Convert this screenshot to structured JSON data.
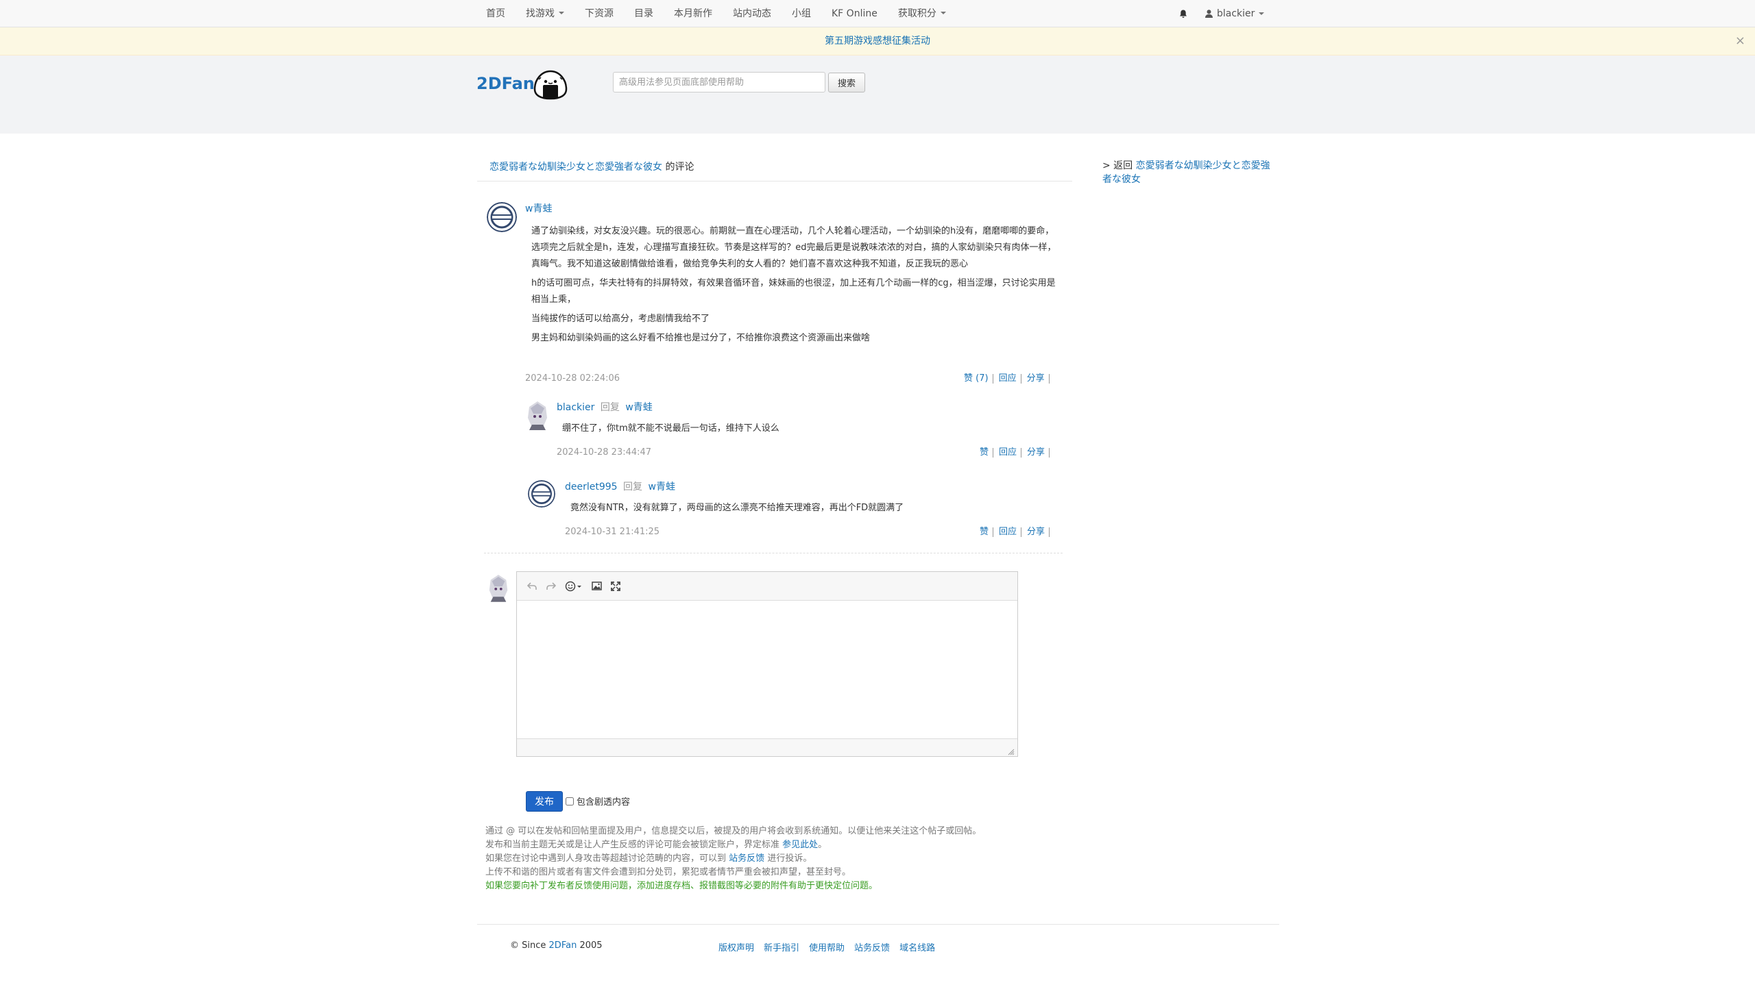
{
  "nav": {
    "items": [
      {
        "label": "首页",
        "dropdown": false
      },
      {
        "label": "找游戏",
        "dropdown": true
      },
      {
        "label": "下资源",
        "dropdown": false
      },
      {
        "label": "目录",
        "dropdown": false
      },
      {
        "label": "本月新作",
        "dropdown": false
      },
      {
        "label": "站内动态",
        "dropdown": false
      },
      {
        "label": "小组",
        "dropdown": false
      },
      {
        "label": "KF Online",
        "dropdown": false
      },
      {
        "label": "获取积分",
        "dropdown": true
      }
    ],
    "username": "blackier"
  },
  "announcement": {
    "text": "第五期游戏感想征集活动",
    "close": "×"
  },
  "header": {
    "logo": "2DFan",
    "search_placeholder": "高级用法参见页面底部使用帮助",
    "search_button": "搜索"
  },
  "page": {
    "game_title": "恋愛弱者な幼馴染少女と恋愛強者な彼女",
    "title_suffix": "的评论",
    "back_prefix": "> 返回",
    "back_link": "恋愛弱者な幼馴染少女と恋愛強者な彼女"
  },
  "main_comment": {
    "author": "w青蛙",
    "paragraphs": [
      "通了幼驯染线，对女友没兴趣。玩的很恶心。前期就一直在心理活动，几个人轮着心理活动，一个幼驯染的h没有，磨磨唧唧的要命，选项完之后就全是h，连发，心理描写直接狂砍。节奏是这样写的？ed完最后更是说教味浓浓的对白，搞的人家幼驯染只有肉体一样，真晦气。我不知道这破剧情做给谁看，做给竞争失利的女人看的？她们喜不喜欢这种我不知道，反正我玩的恶心",
      "h的话可圈可点，华夫社特有的抖屏特效，有效果音循环音，妹妹画的也很涩，加上还有几个动画一样的cg，相当涩爆，只讨论实用是相当上乘，",
      "当纯拔作的话可以给高分，考虑剧情我给不了",
      "男主妈和幼驯染妈画的这么好看不给推也是过分了，不给推你浪费这个资源画出来做啥"
    ],
    "time": "2024-10-28 02:24:06",
    "like": "赞 (7)",
    "reply": "回应",
    "share": "分享"
  },
  "replies": [
    {
      "author": "blackier",
      "reply_word": "回复",
      "reply_target": "w青蛙",
      "text": "绷不住了，你tm就不能不说最后一句话，维持下人设么",
      "time": "2024-10-28 23:44:47",
      "like": "赞",
      "reply": "回应",
      "share": "分享"
    },
    {
      "author": "deerlet995",
      "reply_word": "回复",
      "reply_target": "w青蛙",
      "text": "竟然没有NTR，没有就算了，两母画的这么漂亮不给推天理难容，再出个FD就圆满了",
      "time": "2024-10-31 21:41:25",
      "like": "赞",
      "reply": "回应",
      "share": "分享"
    }
  ],
  "editor": {
    "toolbar_icons": [
      "undo-icon",
      "redo-icon",
      "emoji-icon",
      "image-icon",
      "fullscreen-icon"
    ],
    "publish": "发布",
    "spoiler_label": "包含剧透内容"
  },
  "notes": {
    "line1": "通过 @ 可以在发帖和回帖里面提及用户，信息提交以后，被提及的用户将会收到系统通知。以便让他来关注这个帖子或回帖。",
    "line2_prefix": "发布和当前主题无关或是让人产生反感的评论可能会被锁定账户，界定标准",
    "line2_link": "参见此处",
    "line2_suffix": "。",
    "line3_prefix": "如果您在讨论中遇到人身攻击等超越讨论范畴的内容，可以到",
    "line3_link": "站务反馈",
    "line3_suffix": "进行投诉。",
    "line4": "上传不和谐的图片或者有害文件会遭到扣分处罚，累犯或者情节严重会被扣声望，甚至封号。",
    "line5": "如果您要向补丁发布者反馈使用问题，添加进度存档、报错截图等必要的附件有助于更快定位问题。"
  },
  "footer": {
    "copyright_prefix": "© Since",
    "copyright_brand": "2DFan",
    "copyright_year": "2005",
    "links": [
      "版权声明",
      "新手指引",
      "使用帮助",
      "站务反馈",
      "域名线路"
    ]
  },
  "colors": {
    "link": "#1a73b5",
    "publish": "#1f66c7",
    "announce_bg": "#fcf8e3",
    "header_bg": "#f2f3f5",
    "green_note": "#3a9d23"
  }
}
